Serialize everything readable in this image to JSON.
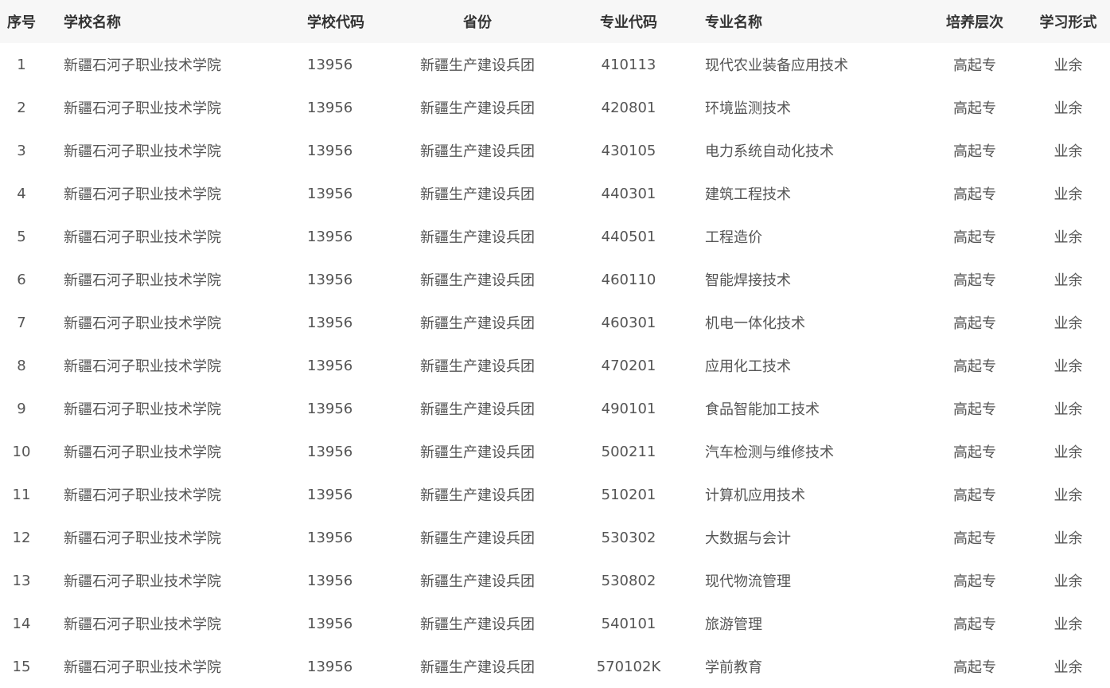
{
  "table": {
    "headers": [
      "序号",
      "学校名称",
      "学校代码",
      "省份",
      "专业代码",
      "专业名称",
      "培养层次",
      "学习形式"
    ],
    "rows": [
      [
        "1",
        "新疆石河子职业技术学院",
        "13956",
        "新疆生产建设兵团",
        "410113",
        "现代农业装备应用技术",
        "高起专",
        "业余"
      ],
      [
        "2",
        "新疆石河子职业技术学院",
        "13956",
        "新疆生产建设兵团",
        "420801",
        "环境监测技术",
        "高起专",
        "业余"
      ],
      [
        "3",
        "新疆石河子职业技术学院",
        "13956",
        "新疆生产建设兵团",
        "430105",
        "电力系统自动化技术",
        "高起专",
        "业余"
      ],
      [
        "4",
        "新疆石河子职业技术学院",
        "13956",
        "新疆生产建设兵团",
        "440301",
        "建筑工程技术",
        "高起专",
        "业余"
      ],
      [
        "5",
        "新疆石河子职业技术学院",
        "13956",
        "新疆生产建设兵团",
        "440501",
        "工程造价",
        "高起专",
        "业余"
      ],
      [
        "6",
        "新疆石河子职业技术学院",
        "13956",
        "新疆生产建设兵团",
        "460110",
        "智能焊接技术",
        "高起专",
        "业余"
      ],
      [
        "7",
        "新疆石河子职业技术学院",
        "13956",
        "新疆生产建设兵团",
        "460301",
        "机电一体化技术",
        "高起专",
        "业余"
      ],
      [
        "8",
        "新疆石河子职业技术学院",
        "13956",
        "新疆生产建设兵团",
        "470201",
        "应用化工技术",
        "高起专",
        "业余"
      ],
      [
        "9",
        "新疆石河子职业技术学院",
        "13956",
        "新疆生产建设兵团",
        "490101",
        "食品智能加工技术",
        "高起专",
        "业余"
      ],
      [
        "10",
        "新疆石河子职业技术学院",
        "13956",
        "新疆生产建设兵团",
        "500211",
        "汽车检测与维修技术",
        "高起专",
        "业余"
      ],
      [
        "11",
        "新疆石河子职业技术学院",
        "13956",
        "新疆生产建设兵团",
        "510201",
        "计算机应用技术",
        "高起专",
        "业余"
      ],
      [
        "12",
        "新疆石河子职业技术学院",
        "13956",
        "新疆生产建设兵团",
        "530302",
        "大数据与会计",
        "高起专",
        "业余"
      ],
      [
        "13",
        "新疆石河子职业技术学院",
        "13956",
        "新疆生产建设兵团",
        "530802",
        "现代物流管理",
        "高起专",
        "业余"
      ],
      [
        "14",
        "新疆石河子职业技术学院",
        "13956",
        "新疆生产建设兵团",
        "540101",
        "旅游管理",
        "高起专",
        "业余"
      ],
      [
        "15",
        "新疆石河子职业技术学院",
        "13956",
        "新疆生产建设兵团",
        "570102K",
        "学前教育",
        "高起专",
        "业余"
      ]
    ]
  }
}
